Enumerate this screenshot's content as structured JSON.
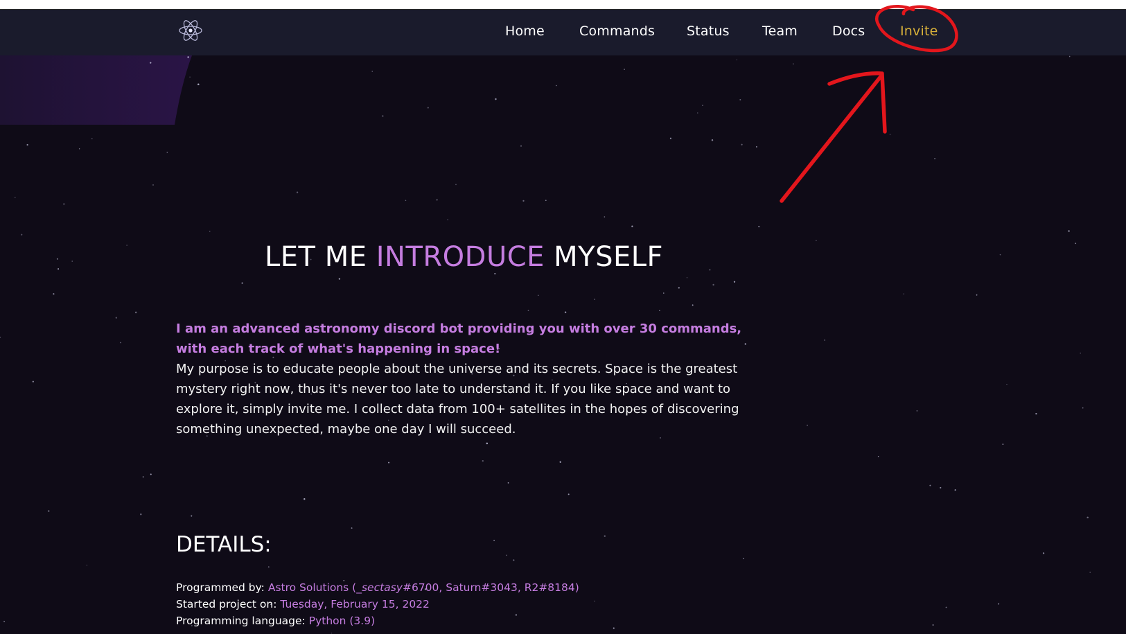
{
  "nav": {
    "logo": "atom-icon",
    "items": [
      "Home",
      "Commands",
      "Status",
      "Team",
      "Docs",
      "Invite"
    ]
  },
  "intro": {
    "title_part1": "LET ME ",
    "title_accent": "INTRODUCE",
    "title_part2": " MYSELF",
    "tagline": "I am an advanced astronomy discord bot providing you with over 30 commands, with each track of what's happening in space!",
    "description": "My purpose is to educate people about the universe and its secrets. Space is the greatest mystery right now, thus it's never too late to understand it. If you like space and want to explore it, simply invite me. I collect data from 100+ satellites in the hopes of discovering something unexpected, maybe one day I will succeed."
  },
  "details": {
    "title": "DETAILS:",
    "programmed_by_label": "Programmed by: ",
    "programmed_by_value_a": "Astro Solutions (",
    "programmed_by_value_italic": "_sectasy",
    "programmed_by_value_b": "#6700, Saturn#3043, R2#8184)",
    "started_label": "Started project on: ",
    "started_value": "Tuesday, February 15, 2022",
    "language_label": "Programming language: ",
    "language_value": "Python (3.9)"
  },
  "colors": {
    "background": "#0f0b17",
    "navbar": "#1a1b2c",
    "accent_purple": "#c57de0",
    "invite_gold": "#d8b13a",
    "annotation_red": "#e3161c"
  }
}
